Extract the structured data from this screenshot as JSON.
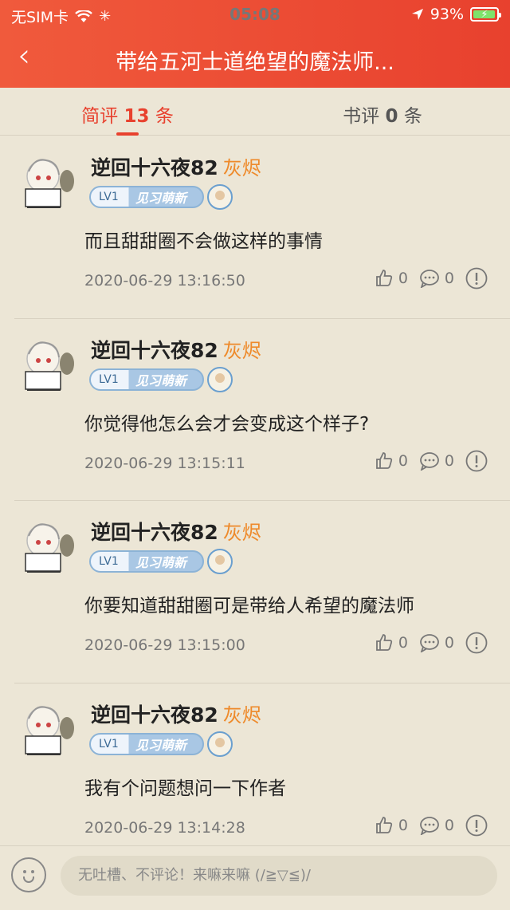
{
  "status": {
    "carrier": "无SIM卡",
    "time": "05:08",
    "battery": "93%"
  },
  "header": {
    "title": "带给五河士道绝望的魔法师..."
  },
  "tabs": [
    {
      "label": "简评",
      "count": "13",
      "unit": "条"
    },
    {
      "label": "书评",
      "count": "0",
      "unit": "条"
    }
  ],
  "comments": [
    {
      "user": "逆回十六夜82",
      "rank": "灰烬",
      "level": "LV1",
      "level_title": "见习萌新",
      "content": "而且甜甜圈不会做这样的事情",
      "time": "2020-06-29 13:16:50",
      "likes": "0",
      "replies": "0"
    },
    {
      "user": "逆回十六夜82",
      "rank": "灰烬",
      "level": "LV1",
      "level_title": "见习萌新",
      "content": "你觉得他怎么会才会变成这个样子?",
      "time": "2020-06-29 13:15:11",
      "likes": "0",
      "replies": "0"
    },
    {
      "user": "逆回十六夜82",
      "rank": "灰烬",
      "level": "LV1",
      "level_title": "见习萌新",
      "content": "你要知道甜甜圈可是带给人希望的魔法师",
      "time": "2020-06-29 13:15:00",
      "likes": "0",
      "replies": "0"
    },
    {
      "user": "逆回十六夜82",
      "rank": "灰烬",
      "level": "LV1",
      "level_title": "见习萌新",
      "content": "我有个问题想问一下作者",
      "time": "2020-06-29 13:14:28",
      "likes": "0",
      "replies": "0"
    }
  ],
  "input": {
    "placeholder": "无吐槽、不评论！来嘛来嘛 (/≧▽≦)/"
  },
  "colors": {
    "accent": "#e8412e",
    "rank": "#ee8a2b",
    "background": "#ece6d6"
  },
  "icons": {
    "back": "chevron-left-icon",
    "like": "thumbs-up-icon",
    "reply": "comment-icon",
    "report": "exclamation-circle-icon",
    "emoji": "smiley-icon"
  }
}
